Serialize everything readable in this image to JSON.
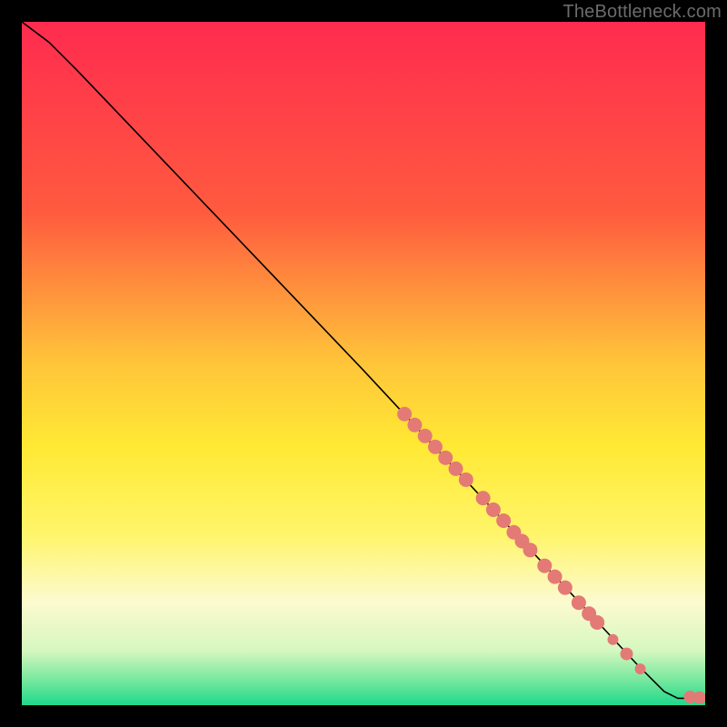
{
  "watermark": "TheBottleneck.com",
  "chart_data": {
    "type": "line",
    "title": "",
    "xlabel": "",
    "ylabel": "",
    "xlim": [
      0,
      100
    ],
    "ylim": [
      0,
      100
    ],
    "gradient_stops": [
      {
        "offset": 0,
        "color": "#ff2b4f"
      },
      {
        "offset": 28,
        "color": "#ff5b3f"
      },
      {
        "offset": 50,
        "color": "#ffc53a"
      },
      {
        "offset": 62,
        "color": "#ffe934"
      },
      {
        "offset": 75,
        "color": "#fff56a"
      },
      {
        "offset": 85,
        "color": "#fcfad0"
      },
      {
        "offset": 92,
        "color": "#d6f7c0"
      },
      {
        "offset": 96,
        "color": "#7ee9a0"
      },
      {
        "offset": 100,
        "color": "#1ed98b"
      }
    ],
    "curve": [
      {
        "x": 0,
        "y": 100
      },
      {
        "x": 4,
        "y": 97
      },
      {
        "x": 8,
        "y": 93
      },
      {
        "x": 50,
        "y": 49
      },
      {
        "x": 90,
        "y": 6
      },
      {
        "x": 94,
        "y": 2
      },
      {
        "x": 96,
        "y": 1
      },
      {
        "x": 100,
        "y": 1
      }
    ],
    "marker_color": "#e47a75",
    "marker_radius_small": 6,
    "marker_radius_large": 8,
    "markers": [
      {
        "x": 56.0,
        "y": 42.6,
        "r": 8
      },
      {
        "x": 57.5,
        "y": 41.0,
        "r": 8
      },
      {
        "x": 59.0,
        "y": 39.4,
        "r": 8
      },
      {
        "x": 60.5,
        "y": 37.8,
        "r": 8
      },
      {
        "x": 62.0,
        "y": 36.2,
        "r": 8
      },
      {
        "x": 63.5,
        "y": 34.6,
        "r": 8
      },
      {
        "x": 65.0,
        "y": 33.0,
        "r": 8
      },
      {
        "x": 67.5,
        "y": 30.3,
        "r": 8
      },
      {
        "x": 69.0,
        "y": 28.6,
        "r": 8
      },
      {
        "x": 70.5,
        "y": 27.0,
        "r": 8
      },
      {
        "x": 72.0,
        "y": 25.3,
        "r": 8
      },
      {
        "x": 73.2,
        "y": 24.0,
        "r": 8
      },
      {
        "x": 74.4,
        "y": 22.7,
        "r": 8
      },
      {
        "x": 76.5,
        "y": 20.4,
        "r": 8
      },
      {
        "x": 78.0,
        "y": 18.8,
        "r": 8
      },
      {
        "x": 79.5,
        "y": 17.2,
        "r": 8
      },
      {
        "x": 81.5,
        "y": 15.0,
        "r": 8
      },
      {
        "x": 83.0,
        "y": 13.4,
        "r": 8
      },
      {
        "x": 84.2,
        "y": 12.1,
        "r": 8
      },
      {
        "x": 86.5,
        "y": 9.6,
        "r": 6
      },
      {
        "x": 88.5,
        "y": 7.5,
        "r": 7
      },
      {
        "x": 90.5,
        "y": 5.3,
        "r": 6
      },
      {
        "x": 97.8,
        "y": 1.2,
        "r": 7
      },
      {
        "x": 99.2,
        "y": 1.1,
        "r": 7
      }
    ]
  }
}
